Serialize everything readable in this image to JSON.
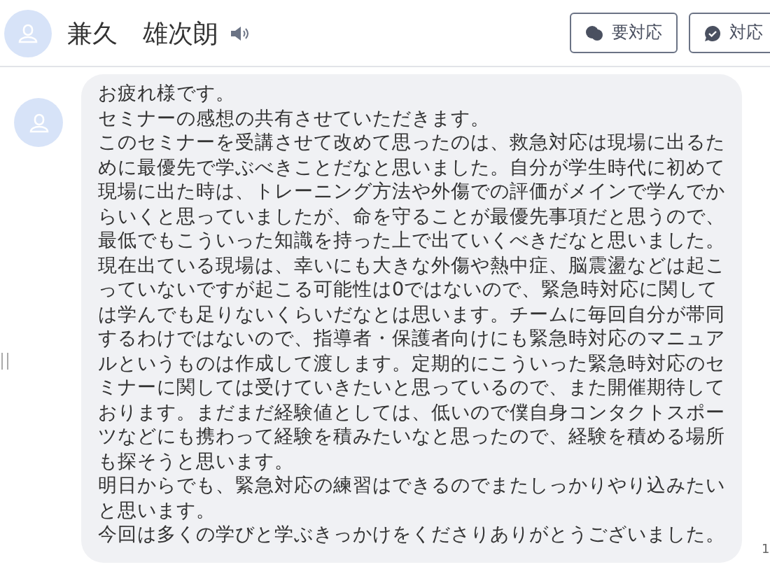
{
  "header": {
    "name": "兼久　雄次朗",
    "buttons": [
      {
        "label": "要対応",
        "kind": "flag"
      },
      {
        "label": "対応",
        "kind": "done"
      }
    ]
  },
  "message": {
    "paragraphs": [
      "お疲れ様です。",
      "セミナーの感想の共有させていただきます。",
      "このセミナーを受講させて改めて思ったのは、救急対応は現場に出るために最優先で学ぶべきことだなと思いました。自分が学生時代に初めて現場に出た時は、トレーニング方法や外傷での評価がメインで学んでからいくと思っていましたが、命を守ることが最優先事項だと思うので、最低でもこういった知識を持った上で出ていくべきだなと思いました。",
      "現在出ている現場は、幸いにも大きな外傷や熱中症、脳震盪などは起こっていないですが起こる可能性は0ではないので、緊急時対応に関しては学んでも足りないくらいだなとは思います。チームに毎回自分が帯同するわけではないので、指導者・保護者向けにも緊急時対応のマニュアルというものは作成して渡します。定期的にこういった緊急時対応のセミナーに関しては受けていきたいと思っているので、また開催期待しております。まだまだ経験値としては、低いので僕自身コンタクトスポーツなどにも携わって経験を積みたいなと思ったので、経験を積める場所も探そうと思います。",
      "明日からでも、緊急対応の練習はできるのでまたしっかりやり込みたいと思います。",
      "今回は多くの学びと学ぶきっかけをくださりありがとうございました。"
    ],
    "time": "1"
  }
}
